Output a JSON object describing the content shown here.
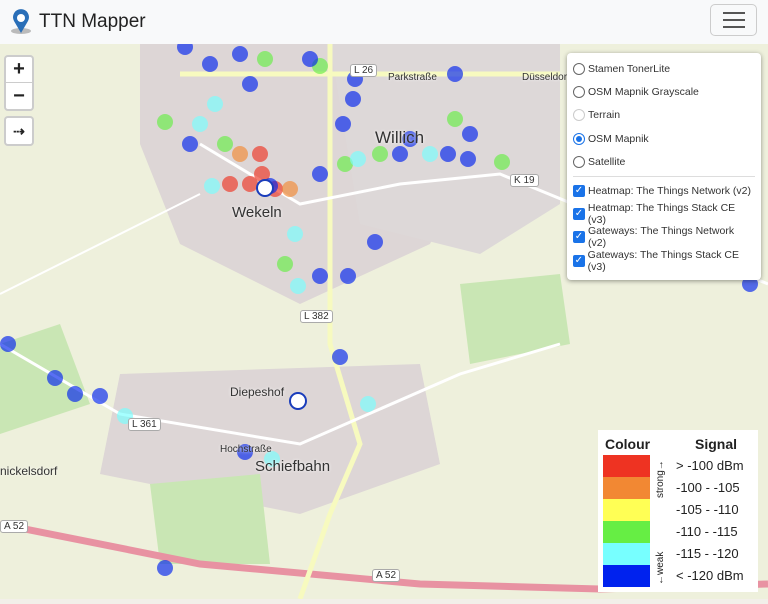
{
  "header": {
    "title": "TTN Mapper",
    "menu_icon": "hamburger-icon"
  },
  "controls": {
    "zoom_in": "+",
    "zoom_out": "−",
    "locate": "⇢"
  },
  "layers": {
    "base": [
      {
        "label": "Stamen TonerLite",
        "selected": false,
        "disabled": false
      },
      {
        "label": "OSM Mapnik Grayscale",
        "selected": false,
        "disabled": false
      },
      {
        "label": "Terrain",
        "selected": false,
        "disabled": true
      },
      {
        "label": "OSM Mapnik",
        "selected": true,
        "disabled": false
      },
      {
        "label": "Satellite",
        "selected": false,
        "disabled": false
      }
    ],
    "overlays": [
      {
        "label": "Heatmap: The Things Network (v2)",
        "checked": true
      },
      {
        "label": "Heatmap: The Things Stack CE (v3)",
        "checked": true
      },
      {
        "label": "Gateways: The Things Network (v2)",
        "checked": true
      },
      {
        "label": "Gateways: The Things Stack CE (v3)",
        "checked": true
      }
    ]
  },
  "legend": {
    "colour_title": "Colour",
    "signal_title": "Signal",
    "strong": "strong→",
    "weak": "←weak",
    "levels": [
      {
        "label": "> -100 dBm",
        "color": "#ee3322"
      },
      {
        "label": "-100 - -105",
        "color": "#f28833"
      },
      {
        "label": "-105 - -110",
        "color": "#ffff55"
      },
      {
        "label": "-110 - -115",
        "color": "#66ee44"
      },
      {
        "label": "-115 - -120",
        "color": "#77ffff"
      },
      {
        "label": "< -120 dBm",
        "color": "#0022ee"
      }
    ]
  },
  "map_labels": {
    "willich": "Willich",
    "wekeln": "Wekeln",
    "diepeshof": "Diepeshof",
    "schiefbahn": "Schiefbahn",
    "nickelsdorf": "nickelsdorf",
    "l382": "L 382",
    "l361": "L 361",
    "k19": "K 19",
    "a52a": "A 52",
    "a52b": "A 52",
    "l26": "L 26",
    "parkstrasse": "Parkstraße",
    "duesseldorf": "Düsseldorf",
    "hochstrasse": "Hochstraße"
  }
}
